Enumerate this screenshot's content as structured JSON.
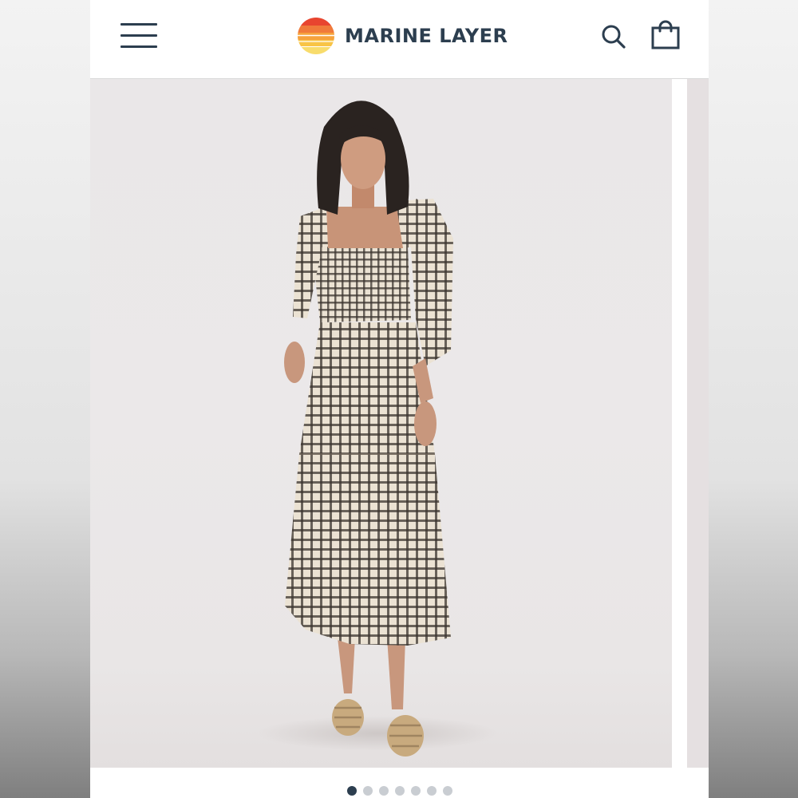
{
  "header": {
    "brand_name": "MARINE LAYER",
    "icons": {
      "menu": "hamburger-menu-icon",
      "logo": "sunset-stripes-logo",
      "search": "search-icon",
      "cart": "shopping-bag-icon"
    }
  },
  "gallery": {
    "total_slides": 7,
    "active_slide": 1
  },
  "colors": {
    "brand_text": "#2c3e4f",
    "logo_stripes": [
      "#e8452f",
      "#f07a3a",
      "#f6a23c",
      "#f8c446",
      "#f8dc6c"
    ],
    "active_dot": "#2c3e4f",
    "inactive_dot": "#c9cdd2"
  }
}
